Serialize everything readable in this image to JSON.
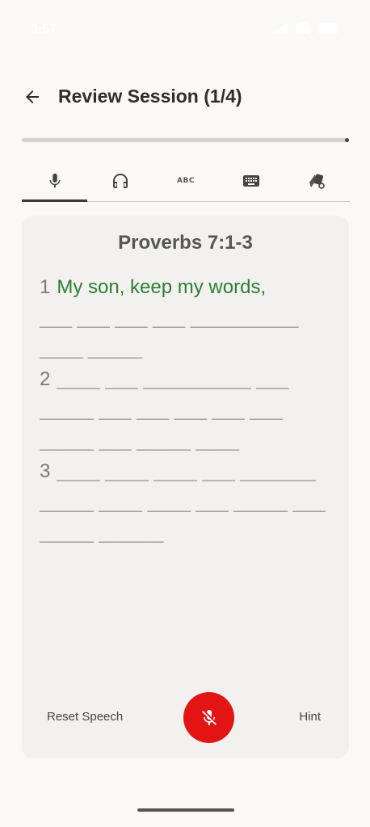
{
  "status_bar": {
    "time": "3:57"
  },
  "header": {
    "title": "Review Session (1/4)"
  },
  "progress": {
    "fraction": 1.0
  },
  "tabs": [
    {
      "name": "mic",
      "icon": "microphone-icon",
      "active": true
    },
    {
      "name": "listen",
      "icon": "headphones-icon",
      "active": false
    },
    {
      "name": "abc",
      "icon": "abc-icon",
      "label": "ABC",
      "active": false
    },
    {
      "name": "keyboard",
      "icon": "keyboard-icon",
      "active": false
    },
    {
      "name": "cards",
      "icon": "cards-icon",
      "active": false
    }
  ],
  "card": {
    "reference": "Proverbs 7:1-3",
    "lines": [
      {
        "num": "1",
        "revealed": "My son, keep my words,",
        "blanks": ""
      },
      {
        "num": "",
        "revealed": "",
        "blanks": "___ ___ ___ ___ __________"
      },
      {
        "num": "",
        "revealed": "",
        "blanks": "____ _____"
      },
      {
        "num": "2",
        "revealed": "",
        "blanks": "____ ___ __________ ___"
      },
      {
        "num": "",
        "revealed": "",
        "blanks": "_____ ___ ___ ___ ___ ___"
      },
      {
        "num": "",
        "revealed": "",
        "blanks": "_____ ___ _____ ____"
      },
      {
        "num": "3",
        "revealed": "",
        "blanks": "____ ____ ____ ___ _______"
      },
      {
        "num": "",
        "revealed": "",
        "blanks": "_____ ____ ____ ___ _____ ___"
      },
      {
        "num": "",
        "revealed": "",
        "blanks": "_____ ______"
      }
    ]
  },
  "controls": {
    "reset_label": "Reset Speech",
    "hint_label": "Hint"
  },
  "colors": {
    "accent_green": "#2e7d32",
    "mic_red": "#e31414"
  }
}
